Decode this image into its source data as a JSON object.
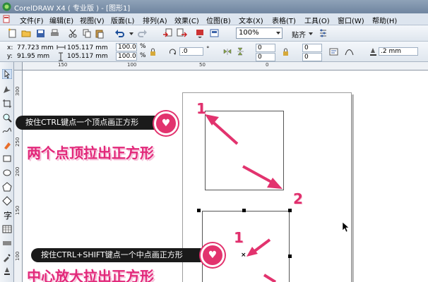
{
  "window": {
    "title": "CorelDRAW X4 ( 专业版 ) - [图形1]"
  },
  "menu": {
    "items": [
      "文件(F)",
      "编辑(E)",
      "视图(V)",
      "版面(L)",
      "排列(A)",
      "效果(C)",
      "位图(B)",
      "文本(X)",
      "表格(T)",
      "工具(O)",
      "窗口(W)",
      "帮助(H)"
    ]
  },
  "toolbar": {
    "zoom": "100%",
    "snap_label": "贴齐"
  },
  "property_bar": {
    "x_label": "x:",
    "x_value": "77.723 mm",
    "y_label": "y:",
    "y_value": "91.95 mm",
    "width_value": "105.117 mm",
    "height_value": "105.117 mm",
    "scale_w": "100.0",
    "scale_h": "100.0",
    "percent": "%",
    "rotation": ".0",
    "degree": "°",
    "corner1": "0",
    "corner2": "0",
    "corner3": "0",
    "corner4": "0",
    "outline_width": ".2 mm"
  },
  "ruler": {
    "top_labels": [
      "150",
      "100",
      "50",
      "0"
    ],
    "left_labels": [
      "300",
      "250",
      "200",
      "150",
      "100"
    ]
  },
  "annotations": {
    "step1_tip": "按住CTRL键点一个顶点画正方形",
    "step1_caption": "两个点顶拉出正方形",
    "step2_tip": "按住CTRL+SHIFT键点一个中点画正方形",
    "step2_caption": "中心放大拉出正方形",
    "num_1a": "1",
    "num_2": "2",
    "num_1b": "1",
    "center_mark": "×",
    "heart": "♥"
  },
  "colors": {
    "accent_pink": "#e2336e",
    "caption_pink": "#e2287a",
    "tooltip_bg": "#1a1a1a"
  }
}
